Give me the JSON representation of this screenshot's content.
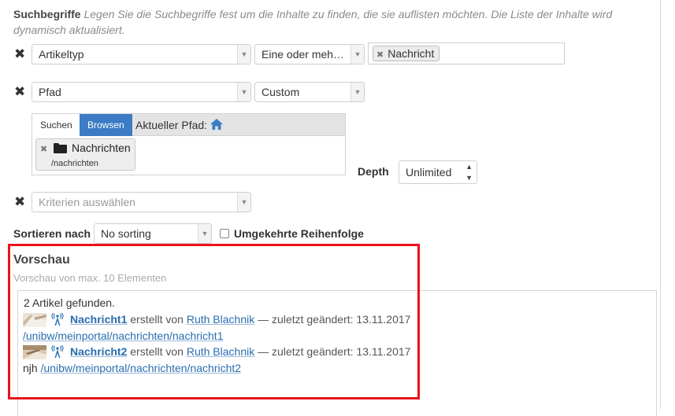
{
  "search_terms": {
    "label": "Suchbegriffe",
    "description": "Legen Sie die Suchbegriffe fest um die Inhalte zu finden, die sie auflisten möchten. Die Liste der Inhalte wird dynamisch aktualisiert."
  },
  "criteria_rows": [
    {
      "field": "Artikeltyp",
      "operator": "Eine oder meh…",
      "token": "Nachricht"
    },
    {
      "field": "Pfad",
      "operator": "Custom"
    }
  ],
  "path_browser": {
    "tab_search": "Suchen",
    "tab_browse": "Browsen",
    "current_path_label": "Aktueller Pfad:",
    "selected_name": "Nachrichten",
    "selected_path": "/nachrichten"
  },
  "depth": {
    "label": "Depth",
    "value": "Unlimited"
  },
  "new_criteria_placeholder": "Kriterien auswählen",
  "sorting": {
    "label": "Sortieren nach",
    "value": "No sorting",
    "reverse_label": "Umgekehrte Reihenfolge",
    "reverse_checked": false
  },
  "preview": {
    "title": "Vorschau",
    "subtitle": "Vorschau von max. 10 Elementen",
    "found": "2 Artikel gefunden.",
    "items": [
      {
        "title": "Nachricht1",
        "created_by_label": "erstellt von",
        "author": "Ruth Blachnik",
        "modified": "— zuletzt geändert: 13.11.2017",
        "prefix": "",
        "path": "/unibw/meinportal/nachrichten/nachricht1"
      },
      {
        "title": "Nachricht2",
        "created_by_label": "erstellt von",
        "author": "Ruth Blachnik",
        "modified": "— zuletzt geändert: 13.11.2017",
        "prefix": "njh",
        "path": "/unibw/meinportal/nachrichten/nachricht2"
      }
    ]
  },
  "colors": {
    "highlight_border": "#e8131b",
    "link": "#2a6db0",
    "active_tab": "#3b7cc4"
  },
  "icons": [
    "remove-icon",
    "dropdown-arrow-icon",
    "home-icon",
    "folder-icon",
    "news-type-icon",
    "spin-arrows-icon"
  ]
}
